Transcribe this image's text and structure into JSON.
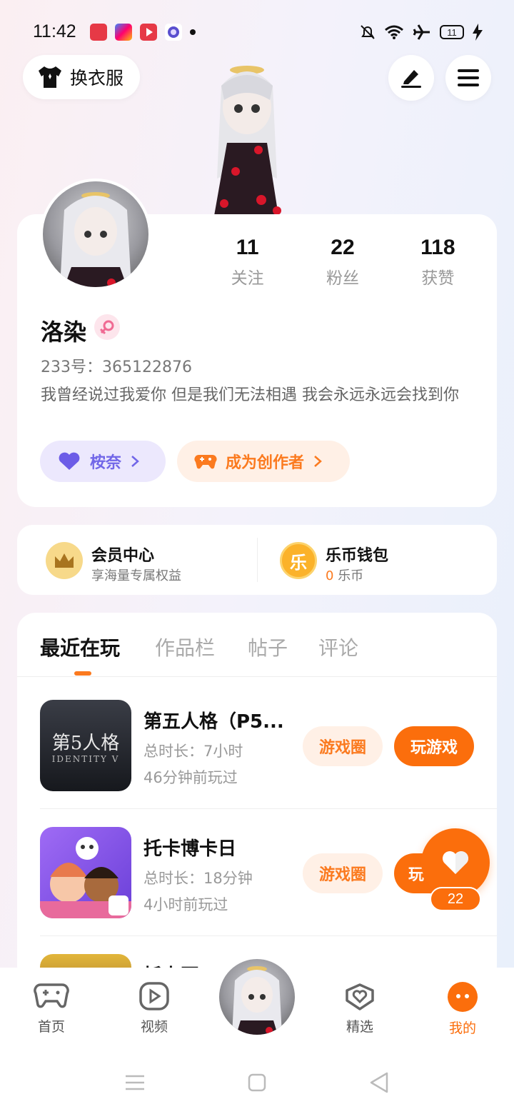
{
  "status_bar": {
    "time": "11:42",
    "battery": "11"
  },
  "top": {
    "wardrobe_label": "换衣服"
  },
  "profile": {
    "following": "11",
    "following_label": "关注",
    "fans": "22",
    "fans_label": "粉丝",
    "likes": "118",
    "likes_label": "获赞",
    "name": "洛染",
    "uid": "233号：365122876",
    "bio": "我曾经说过我爱你 但是我们无法相遇 我会永远永远会找到你",
    "school_label": "桉奈",
    "creator_label": "成为创作者"
  },
  "member": {
    "vip_title": "会员中心",
    "vip_sub": "享海量专属权益",
    "wallet_title": "乐币钱包",
    "wallet_amount": "0",
    "wallet_unit": "乐币",
    "wallet_icon_text": "乐"
  },
  "tabs": [
    "最近在玩",
    "作品栏",
    "帖子",
    "评论"
  ],
  "games": [
    {
      "title": "第五人格（P5...",
      "duration": "总时长：7小时",
      "last_played": "46分钟前玩过",
      "circle": "游戏圈",
      "play": "玩游戏",
      "thumb_text": "第5人格",
      "thumb_sub": "IDENTITY V"
    },
    {
      "title": "托卡博卡日",
      "duration": "总时长：18分钟",
      "last_played": "4小时前玩过",
      "circle": "游戏圈",
      "play": "玩",
      "thumb_text": "",
      "thumb_sub": ""
    },
    {
      "title": "托卡豆",
      "duration": "",
      "last_played": "",
      "circle": "",
      "play": "",
      "thumb_text": "",
      "thumb_sub": ""
    }
  ],
  "fab": {
    "count": "22"
  },
  "nav": [
    {
      "label": "首页",
      "icon": "gamepad-icon"
    },
    {
      "label": "视频",
      "icon": "video-icon"
    },
    {
      "label": "精选",
      "icon": "heart-chat-icon"
    },
    {
      "label": "我的",
      "icon": "profile-face-icon"
    }
  ],
  "colors": {
    "accent": "#fb6e0c",
    "purple": "#7166e8"
  }
}
